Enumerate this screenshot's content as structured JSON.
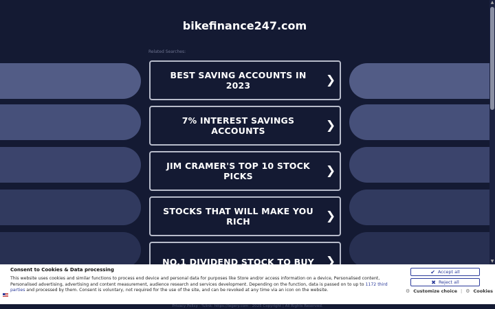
{
  "header": {
    "site_title": "bikefinance247.com"
  },
  "related": {
    "label": "Related Searches:"
  },
  "tiles": [
    {
      "label": "BEST SAVING ACCOUNTS IN 2023"
    },
    {
      "label": "7% INTEREST SAVINGS ACCOUNTS"
    },
    {
      "label": "JIM CRAMER'S TOP 10 STOCK PICKS"
    },
    {
      "label": "STOCKS THAT WILL MAKE YOU RICH"
    },
    {
      "label": "NO.1 DIVIDEND STOCK TO BUY"
    }
  ],
  "chevron_glyph": "❯",
  "footer": {
    "text": "Privacy Policy · %link: https://legery.com · 2025 Copyright | All Rights Reserved."
  },
  "consent": {
    "title": "Consent to Cookies & Data processing",
    "text_before_link": "This website uses cookies and similar functions to process end device and personal data for purposes like Store and/or access information on a device, Personalised content, Personalised advertising, advertising and content measurement, audience research and services development. Depending on the function, data is passed on to up to ",
    "link_text": "1172 third parties",
    "text_after_link": " and processed by them. Consent is voluntary, not required for the use of the site, and can be revoked at any time via an icon on the website.",
    "accept_label": "Accept all",
    "reject_label": "Reject all",
    "customize_label": "Customize choice",
    "separator": "|",
    "cookies_label": "Cookies"
  },
  "icons": {
    "check": "check-icon",
    "reject": "x-icon",
    "gear": "gear-icon",
    "flag": "flag-icon",
    "chevron": "chevron-right-icon"
  },
  "colors": {
    "background": "#141a33",
    "accent": "#2a3a9a",
    "tile_border": "#b8bccb"
  }
}
